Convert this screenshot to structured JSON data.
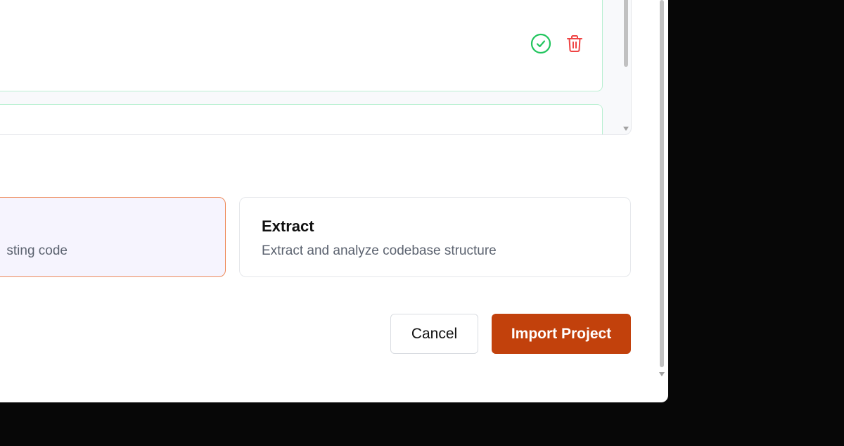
{
  "colors": {
    "success": "#22c55e",
    "danger": "#ef4444",
    "accent": "#c2410c",
    "selected_border": "#ee8a5a",
    "selected_bg": "#f6f4fe"
  },
  "file_list": {
    "items": [
      {
        "actions": [
          "check-circle-icon",
          "trash-icon"
        ]
      },
      {
        "actions": []
      }
    ]
  },
  "mode_options": [
    {
      "title": "",
      "description": "sting code",
      "selected": true
    },
    {
      "title": "Extract",
      "description": "Extract and analyze codebase structure",
      "selected": false
    }
  ],
  "footer": {
    "cancel_label": "Cancel",
    "import_label": "Import Project"
  }
}
